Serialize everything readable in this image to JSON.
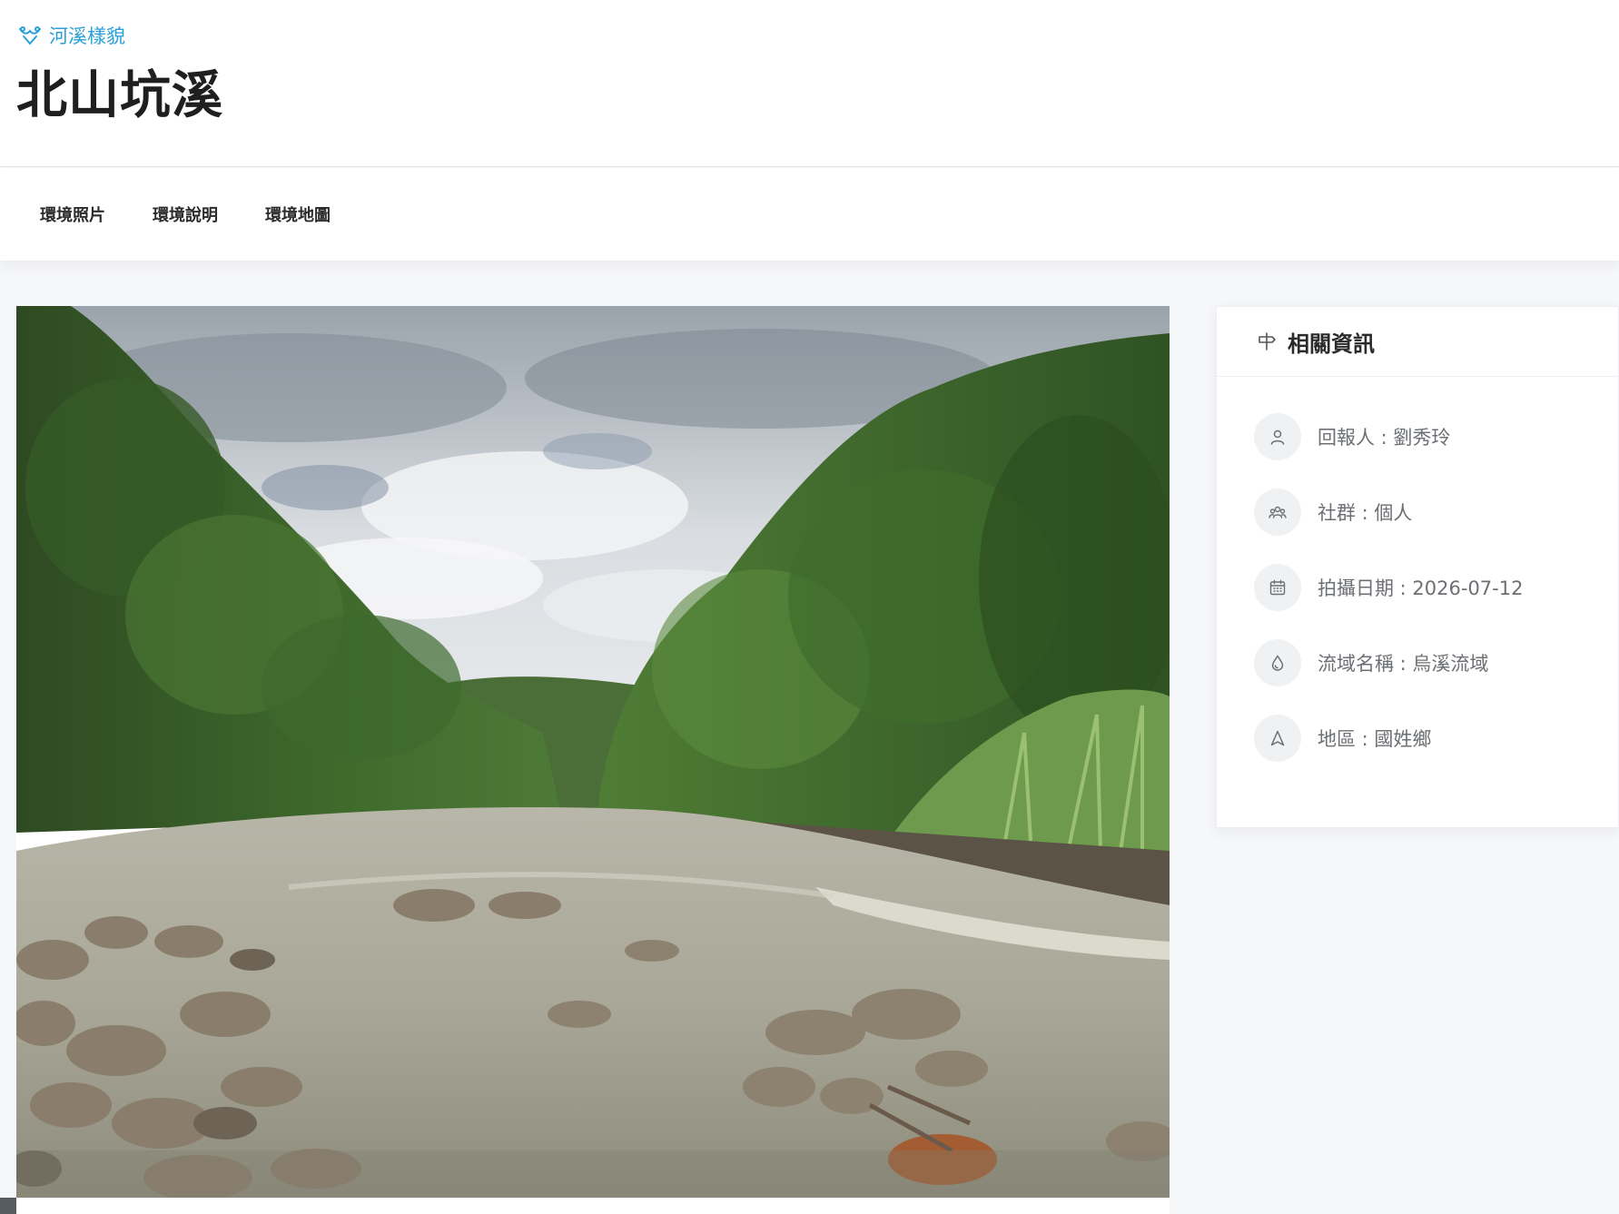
{
  "header": {
    "breadcrumb": "河溪樣貌",
    "title": "北山坑溪"
  },
  "tabs": [
    {
      "label": "環境照片"
    },
    {
      "label": "環境說明"
    },
    {
      "label": "環境地圖"
    }
  ],
  "info": {
    "title": "相關資訊",
    "items": [
      {
        "icon": "user-icon",
        "text": "回報人 : 劉秀玲"
      },
      {
        "icon": "group-icon",
        "text": "社群 : 個人"
      },
      {
        "icon": "calendar-icon",
        "text": "拍攝日期 : 2026-07-12"
      },
      {
        "icon": "water-drop-icon",
        "text": "流域名稱 : 烏溪流域"
      },
      {
        "icon": "location-arrow-icon",
        "text": "地區 : 國姓鄉"
      }
    ]
  },
  "colors": {
    "accent": "#2aa0d8",
    "background": "#f6f7f9",
    "icon_bg": "#f0f1f3"
  }
}
